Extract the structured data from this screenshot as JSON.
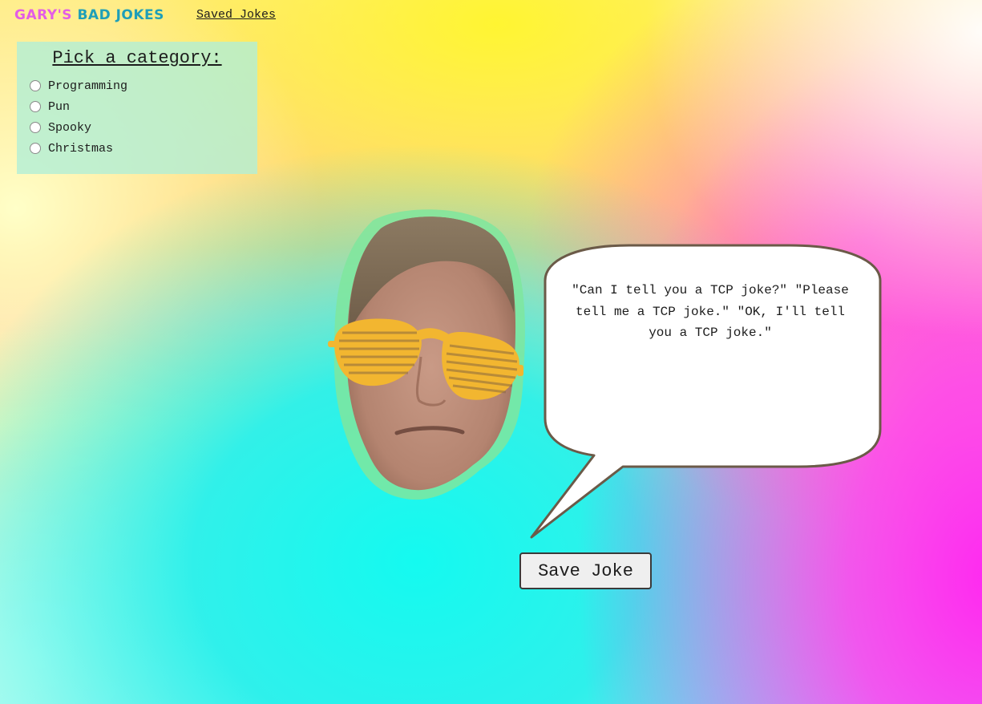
{
  "header": {
    "logo_part1": "GARY'S",
    "logo_part2": "BAD JOKES",
    "nav_saved_jokes": "Saved Jokes"
  },
  "category_panel": {
    "title": "Pick a category:",
    "options": [
      {
        "label": "Programming",
        "selected": false
      },
      {
        "label": "Pun",
        "selected": false
      },
      {
        "label": "Spooky",
        "selected": false
      },
      {
        "label": "Christmas",
        "selected": false
      }
    ]
  },
  "joke": {
    "text": "\"Can I tell you a TCP joke?\" \"Please tell me a TCP joke.\" \"OK, I'll tell you a TCP joke.\""
  },
  "actions": {
    "save_label": "Save Joke"
  },
  "colors": {
    "logo_pink": "#e35ce6",
    "logo_teal": "#1f9fb8",
    "sunglasses": "#f2b630",
    "bubble_border": "#6b5a48"
  }
}
